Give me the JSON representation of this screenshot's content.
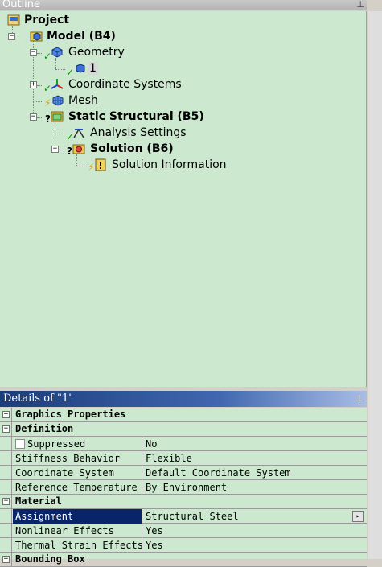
{
  "outline": {
    "title": "Outline",
    "pin_icon": "pin-icon",
    "tree": [
      {
        "label": "Project",
        "icon": "project-icon",
        "bold": true
      },
      {
        "label": "Model (B4)",
        "icon": "model-icon",
        "bold": true
      },
      {
        "label": "Geometry",
        "icon": "geometry-icon",
        "bold": false
      },
      {
        "label": "1",
        "icon": "body-icon",
        "bold": false
      },
      {
        "label": "Coordinate Systems",
        "icon": "coordinate-systems-icon",
        "bold": false
      },
      {
        "label": "Mesh",
        "icon": "mesh-icon",
        "bold": false
      },
      {
        "label": "Static Structural (B5)",
        "icon": "static-structural-icon",
        "bold": true
      },
      {
        "label": "Analysis Settings",
        "icon": "analysis-settings-icon",
        "bold": false
      },
      {
        "label": "Solution (B6)",
        "icon": "solution-icon",
        "bold": true
      },
      {
        "label": "Solution Information",
        "icon": "solution-information-icon",
        "bold": false
      }
    ]
  },
  "details": {
    "title": "Details of \"1\"",
    "pin_icon": "pin-icon",
    "categories": {
      "graphics": "Graphics Properties",
      "definition": "Definition",
      "material": "Material"
    },
    "rows": {
      "suppressed": {
        "name": "Suppressed",
        "value": "No"
      },
      "stiffness": {
        "name": "Stiffness Behavior",
        "value": "Flexible"
      },
      "coordinate": {
        "name": "Coordinate System",
        "value": "Default Coordinate System"
      },
      "reftemp": {
        "name": "Reference Temperature",
        "value": "By Environment"
      },
      "assignment": {
        "name": "Assignment",
        "value": "Structural Steel"
      },
      "nonlinear": {
        "name": "Nonlinear Effects",
        "value": "Yes"
      },
      "thermal": {
        "name": "Thermal Strain Effects",
        "value": "Yes"
      }
    },
    "next_category_partial": "Bounding Box"
  },
  "colors": {
    "tree_bg": "#cce8cf",
    "title_bar_start": "#1b3c7a",
    "title_bar_end": "#a9bde4",
    "selection": "#0a246a",
    "check_green": "#0a8a0a"
  }
}
